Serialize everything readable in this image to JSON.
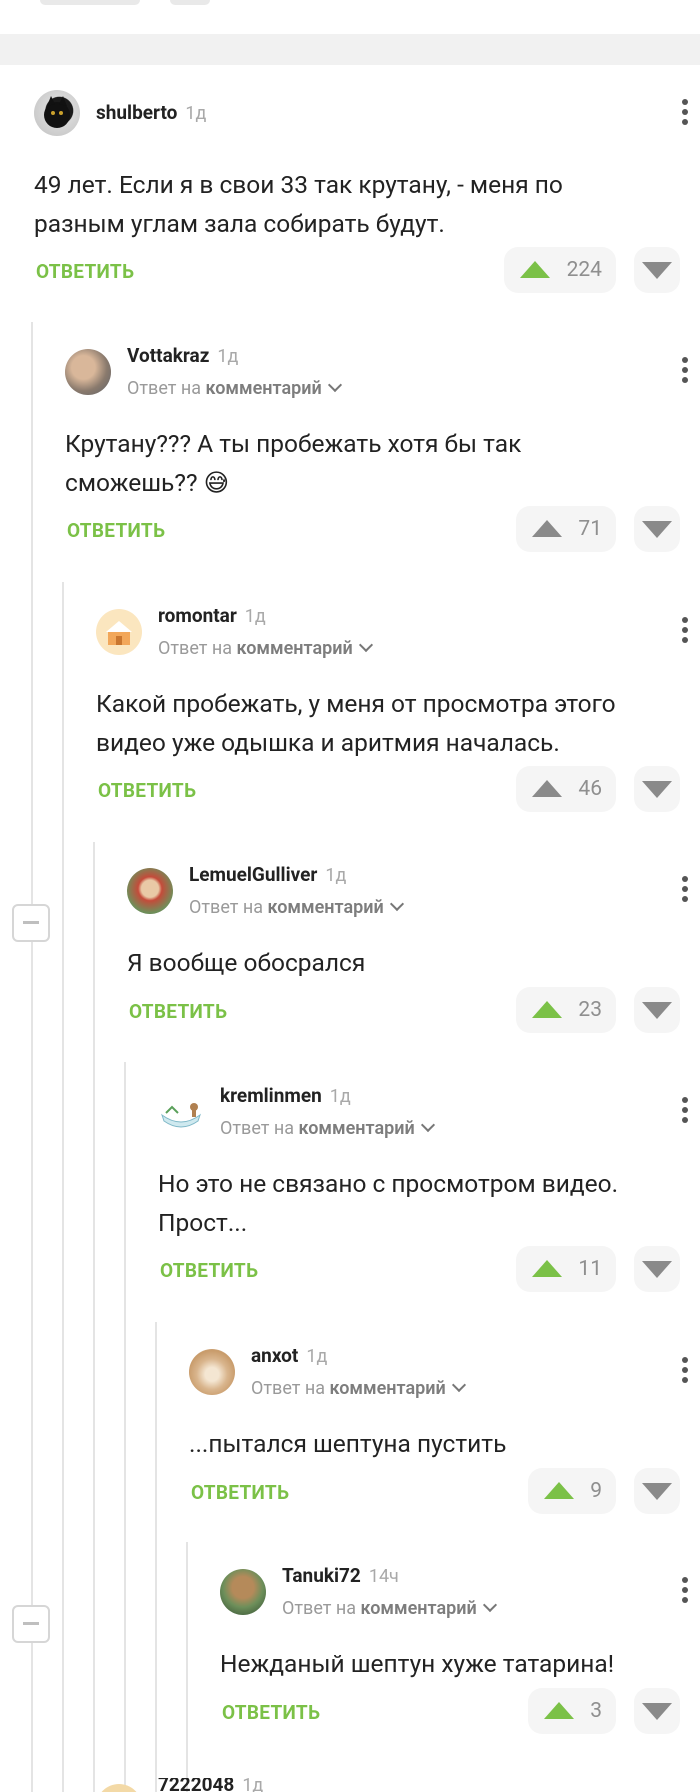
{
  "comments": [
    {
      "user": "shulberto",
      "time": "1д",
      "reply_prefix": "",
      "reply_target": "",
      "body": "49 лет. Если я в свои 33 так крутану, - меня по разным углам зала собирать будут.",
      "answer": "ОТВЕТИТЬ",
      "votes": "224",
      "voted_up": true
    },
    {
      "user": "Vottakraz",
      "time": "1д",
      "reply_prefix": "Ответ на",
      "reply_target": "комментарий",
      "body": "Крутану??? А ты пробежать хотя бы так сможешь?? 😅",
      "answer": "ОТВЕТИТЬ",
      "votes": "71",
      "voted_up": false
    },
    {
      "user": "romontar",
      "time": "1д",
      "reply_prefix": "Ответ на",
      "reply_target": "комментарий",
      "body": "Какой пробежать, у меня от просмотра этого видео уже одышка и аритмия началась.",
      "answer": "ОТВЕТИТЬ",
      "votes": "46",
      "voted_up": false
    },
    {
      "user": "LemuelGulliver",
      "time": "1д",
      "reply_prefix": "Ответ на",
      "reply_target": "комментарий",
      "body": "Я вообще обосрался",
      "answer": "ОТВЕТИТЬ",
      "votes": "23",
      "voted_up": true
    },
    {
      "user": "kremlinmen",
      "time": "1д",
      "reply_prefix": "Ответ на",
      "reply_target": "комментарий",
      "body": "Но это не связано с просмотром видео. Прост...",
      "answer": "ОТВЕТИТЬ",
      "votes": "11",
      "voted_up": true
    },
    {
      "user": "anxot",
      "time": "1д",
      "reply_prefix": "Ответ на",
      "reply_target": "комментарий",
      "body": "...пытался шептуна пустить",
      "answer": "ОТВЕТИТЬ",
      "votes": "9",
      "voted_up": true
    },
    {
      "user": "Tanuki72",
      "time": "14ч",
      "reply_prefix": "Ответ на",
      "reply_target": "комментарий",
      "body": "Нежданый шептун хуже татарина!",
      "answer": "ОТВЕТИТЬ",
      "votes": "3",
      "voted_up": true
    }
  ],
  "partial_next": {
    "user": "7222048",
    "time": "1д"
  },
  "colors": {
    "accent_green": "#7bc147",
    "muted": "#8a8a8a"
  },
  "icons": [
    "more-vert-icon",
    "chevron-down-icon",
    "arrow-up-icon",
    "arrow-down-icon",
    "collapse-minus-icon"
  ]
}
